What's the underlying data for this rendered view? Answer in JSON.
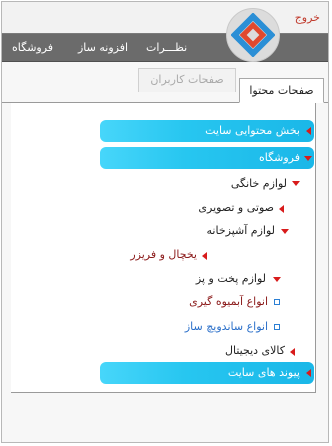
{
  "header": {
    "logout_label": "خروج"
  },
  "nav": {
    "items": [
      "نظـــرات",
      "افزونه ساز",
      "فروشگاه"
    ]
  },
  "tabs": [
    {
      "label": "صفحات محتوا",
      "active": true
    },
    {
      "label": "صفحات کاربران",
      "active": false
    }
  ],
  "menu": {
    "site_content": "بخش محتوایی سایت",
    "shop": "فروشگاه",
    "home_appliances": "لوازم خانگی",
    "audio_video": "صوتی و تصویری",
    "kitchen": "لوازم آشپزخانه",
    "fridge": "یخچال و فریزر",
    "cooking": "لوازم پخت و پز",
    "juicers": "انواع آبمیوه گیری",
    "sandwich_makers": "انواع ساندویچ ساز",
    "digital": "کالای دیجیتال",
    "site_links": "پیوند های سایت"
  },
  "colors": {
    "accent_bar": "#27c6f0",
    "arrow": "#d81b1b",
    "nav_bg": "#6b6b6b",
    "logout": "#c0392b"
  }
}
